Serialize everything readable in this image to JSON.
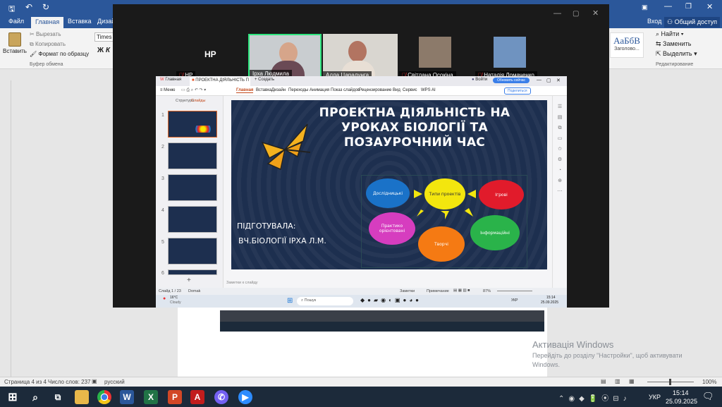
{
  "word": {
    "tabs": [
      "Файл",
      "Главная",
      "Вставка",
      "Дизай"
    ],
    "login": "Вход",
    "share": "Общий доступ",
    "clipboard": {
      "paste": "Вставить",
      "cut": "Вырезать",
      "copy": "Копировать",
      "format": "Формат по образцу",
      "group": "Буфер обмена"
    },
    "font": "Times I",
    "styles": {
      "sample": "АаБбВ",
      "name": "Заголово..."
    },
    "editing": {
      "find": "Найти",
      "replace": "Заменить",
      "select": "Выделить",
      "group": "Редактирование"
    },
    "status": {
      "page": "Страница 4 из 4",
      "words": "Число слов: 237",
      "lang": "русский",
      "zoom": "100%"
    },
    "activation": {
      "title": "Активація Windows",
      "line1": "Перейдіть до розділу \"Настройки\", щоб активувати",
      "line2": "Windows."
    }
  },
  "zoom": {
    "label_np": "НР",
    "participants": [
      {
        "name": "НР"
      },
      {
        "name": "Ірха Людмила"
      },
      {
        "name": "Алла Царалунга"
      },
      {
        "name": "Світлана Осокіна"
      },
      {
        "name": "Наталія Ломаченко"
      }
    ]
  },
  "wps": {
    "tab_home": "Главная",
    "file_name": "ПРОЕКТНА ДІЯЛЬНІСТЬ П",
    "new_tab": "Создать",
    "login": "Войти",
    "update": "Обновить сейчас",
    "menu": "Меню",
    "ribbon": [
      "Главная",
      "Вставка",
      "Дизайн",
      "Переходы",
      "Анимация",
      "Показ слайдов",
      "Рецензирование",
      "Вид",
      "Сервис",
      "WPS AI"
    ],
    "share": "Поделиться",
    "panel_tabs": [
      "Структура",
      "Слайды"
    ],
    "notes_placeholder": "Заметки к слайду",
    "status": {
      "slide": "Слайд 1 / 23",
      "theme": "Domak",
      "notes": "Заметки",
      "comment": "Примечание",
      "zoom": "87%"
    },
    "weather": {
      "temp": "16°C",
      "cond": "Cloudy"
    },
    "search": "Пошук",
    "lang": "УКР",
    "time": "15:14",
    "date": "25.09.2025"
  },
  "slide": {
    "title": [
      "ПРОЕКТНА ДІЯЛЬНІСТЬ НА",
      "УРОКАХ БІОЛОГІЇ ТА",
      "ПОЗАУРОЧНИЙ ЧАС"
    ],
    "author1": "ПІДГОТУВАЛА:",
    "author2": "ВЧ.БІОЛОГІЇ  ІРХА Л.М.",
    "center": "Типи проектів",
    "bubbles": {
      "research": "Дослідницькі",
      "game": "Ігрові",
      "practice": "Практико орієнтовані",
      "info": "Інформаційні",
      "creative": "Творчі"
    }
  },
  "taskbar": {
    "lang": "УКР",
    "time": "15:14",
    "date": "25.09.2025"
  },
  "colors": {
    "word_blue": "#2b579a",
    "slide_bg": "#1d2f4f",
    "title": "#ffffff"
  }
}
